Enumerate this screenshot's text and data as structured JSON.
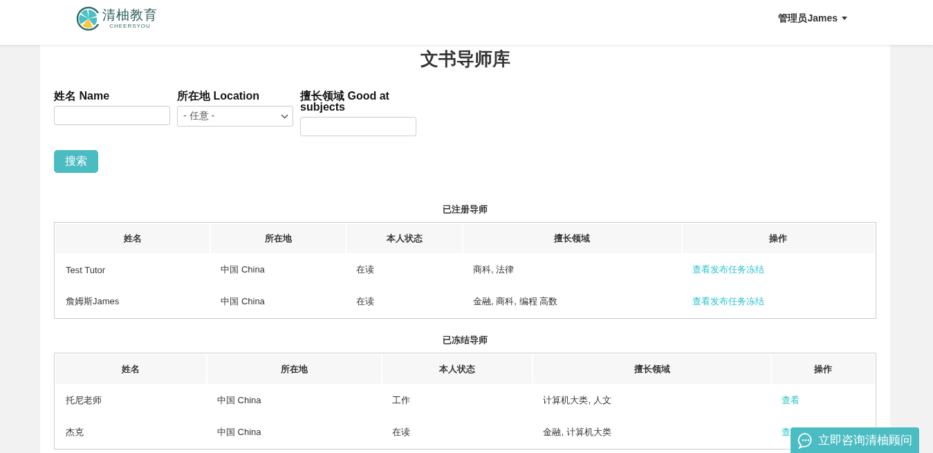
{
  "header": {
    "logo_text": "清柚教育",
    "logo_subtext": "CHEERSYOU",
    "user_menu": "管理员James"
  },
  "title": "文书导师库",
  "filters": [
    {
      "kind": "input",
      "label": "姓名 Name"
    },
    {
      "kind": "select",
      "label": "所在地 Location",
      "value": "- 任意 -"
    },
    {
      "kind": "input",
      "label": "擅长领域 Good at subjects"
    }
  ],
  "search_button": "搜索",
  "tables": [
    {
      "caption": "已注册导师",
      "columns": [
        "姓名",
        "所在地",
        "本人状态",
        "擅长领域",
        "操作"
      ],
      "rows": [
        {
          "cells": [
            "Test Tutor",
            "中国 China",
            "在读",
            "商科, 法律"
          ],
          "actions": [
            "查看",
            "发布任务",
            "冻结"
          ]
        },
        {
          "cells": [
            "詹姆斯James",
            "中国 China",
            "在读",
            "金融, 商科, 编程 高数"
          ],
          "actions": [
            "查看",
            "发布任务",
            "冻结"
          ]
        }
      ]
    },
    {
      "caption": "已冻结导师",
      "columns": [
        "姓名",
        "所在地",
        "本人状态",
        "擅长领域",
        "操作"
      ],
      "rows": [
        {
          "cells": [
            "托尼老师",
            "中国 China",
            "工作",
            "计算机大类, 人文"
          ],
          "actions": [
            "查看"
          ]
        },
        {
          "cells": [
            "杰克",
            "中国 China",
            "在读",
            "金融, 计算机大类"
          ],
          "actions": [
            "查"
          ]
        }
      ]
    }
  ],
  "chat_button": "立即咨询清柚顾问"
}
